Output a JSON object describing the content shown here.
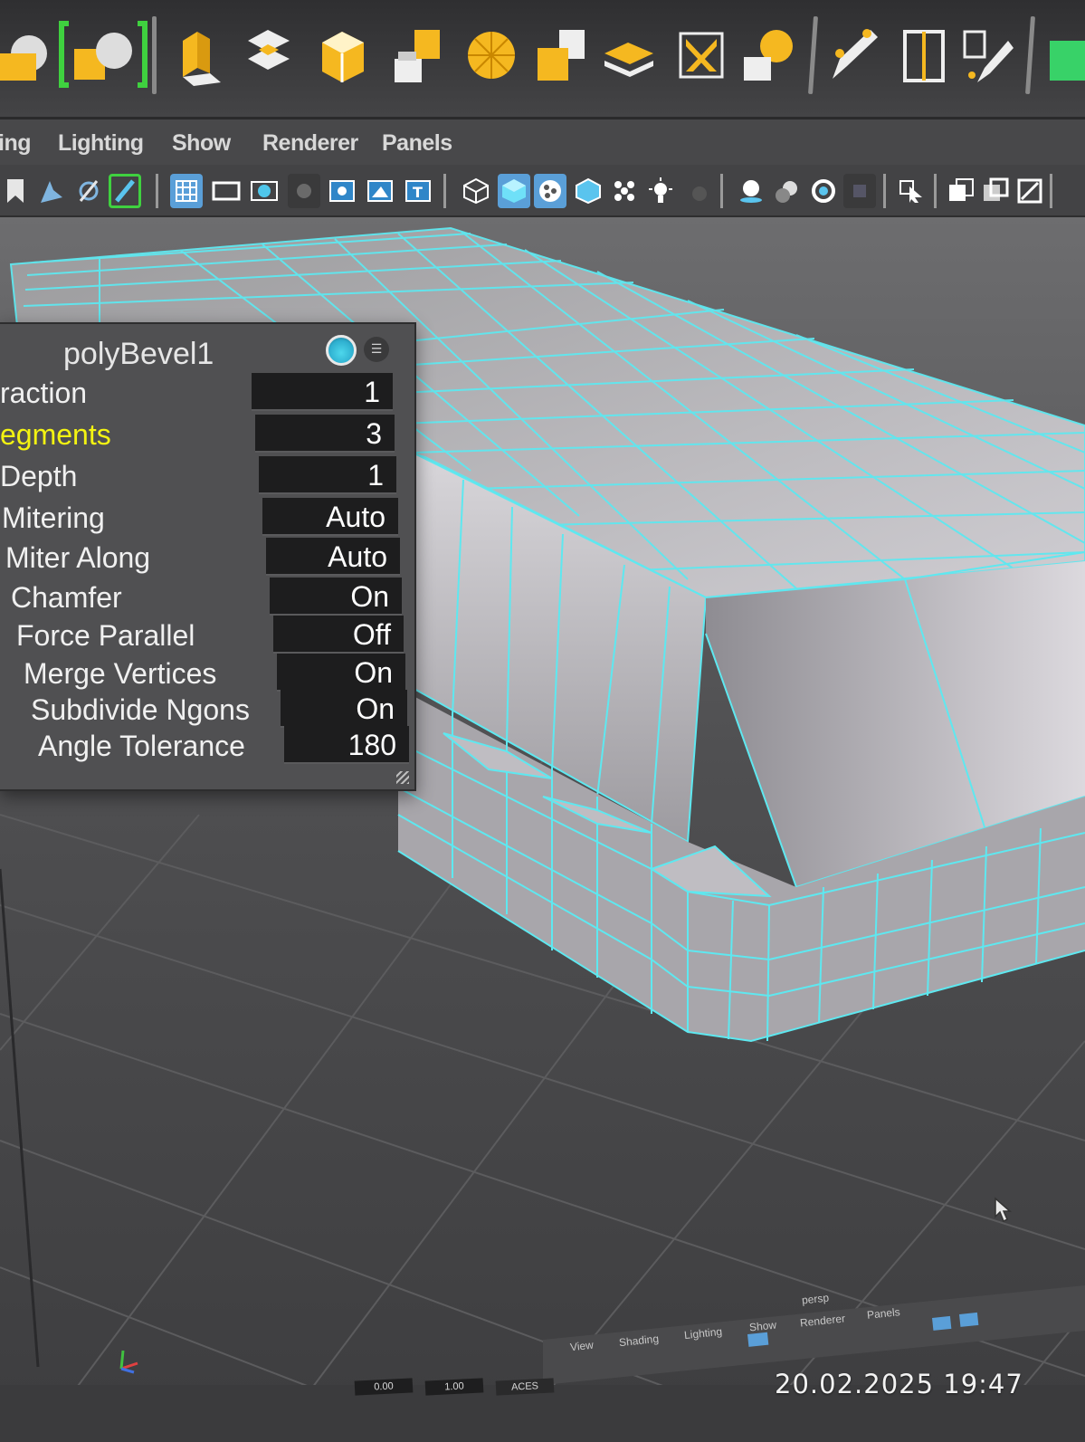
{
  "menubar": {
    "items": [
      "ing",
      "Lighting",
      "Show",
      "Renderer",
      "Panels"
    ]
  },
  "bevel_panel": {
    "title": "polyBevel1",
    "rows": [
      {
        "label": "raction",
        "value": "1",
        "highlight": false
      },
      {
        "label": "egments",
        "value": "3",
        "highlight": true
      },
      {
        "label": "Depth",
        "value": "1",
        "highlight": false
      },
      {
        "label": "Mitering",
        "value": "Auto",
        "highlight": false
      },
      {
        "label": "Miter Along",
        "value": "Auto",
        "highlight": false
      },
      {
        "label": "Chamfer",
        "value": "On",
        "highlight": false
      },
      {
        "label": "Force Parallel",
        "value": "Off",
        "highlight": false
      },
      {
        "label": "Merge Vertices",
        "value": "On",
        "highlight": false
      },
      {
        "label": "Subdivide Ngons",
        "value": "On",
        "highlight": false
      },
      {
        "label": "Angle Tolerance",
        "value": "180",
        "highlight": false
      }
    ]
  },
  "mini_view": {
    "camera_label": "persp",
    "menu_items": [
      "View",
      "Shading",
      "Lighting",
      "Show",
      "Renderer",
      "Panels"
    ]
  },
  "bottom_bar": {
    "field_1": "0.00",
    "field_2": "1.00",
    "color_space": "ACES"
  },
  "timestamp": "20.02.2025   19:47",
  "colors": {
    "wireframe_highlight": "#5ee8f0",
    "attr_highlight": "#f3f312",
    "shelf_icon_yellow": "#f5b820",
    "active_toggle_blue": "#5a9fd8"
  },
  "icons": {
    "shelf": [
      "curve-to-poly-icon",
      "bracket-select-icon",
      "extrude-icon",
      "bridge-icon",
      "bevel-icon",
      "append-icon",
      "poke-icon",
      "wedge-icon",
      "combine-icon",
      "separate-icon",
      "multicut-icon",
      "target-weld-icon",
      "connect-icon",
      "edit-loop-icon",
      "mesh-tool-icon"
    ],
    "panel": [
      "bookmark-icon",
      "camera-attr-icon",
      "snap-icon",
      "pencil-icon",
      "grid-icon",
      "film-gate-icon",
      "resolution-gate-icon",
      "gate-mask-icon",
      "field-chart-icon",
      "safe-action-icon",
      "safe-title-icon",
      "wireframe-icon",
      "smooth-shade-icon",
      "wire-on-shaded-icon",
      "textured-icon",
      "use-all-lights-icon",
      "shadows-icon",
      "ambient-occlusion-icon",
      "motion-blur-icon",
      "anti-alias-icon",
      "depth-of-field-icon",
      "isolate-select-icon",
      "xray-icon",
      "xray-joints-icon",
      "backface-culling-icon"
    ]
  }
}
